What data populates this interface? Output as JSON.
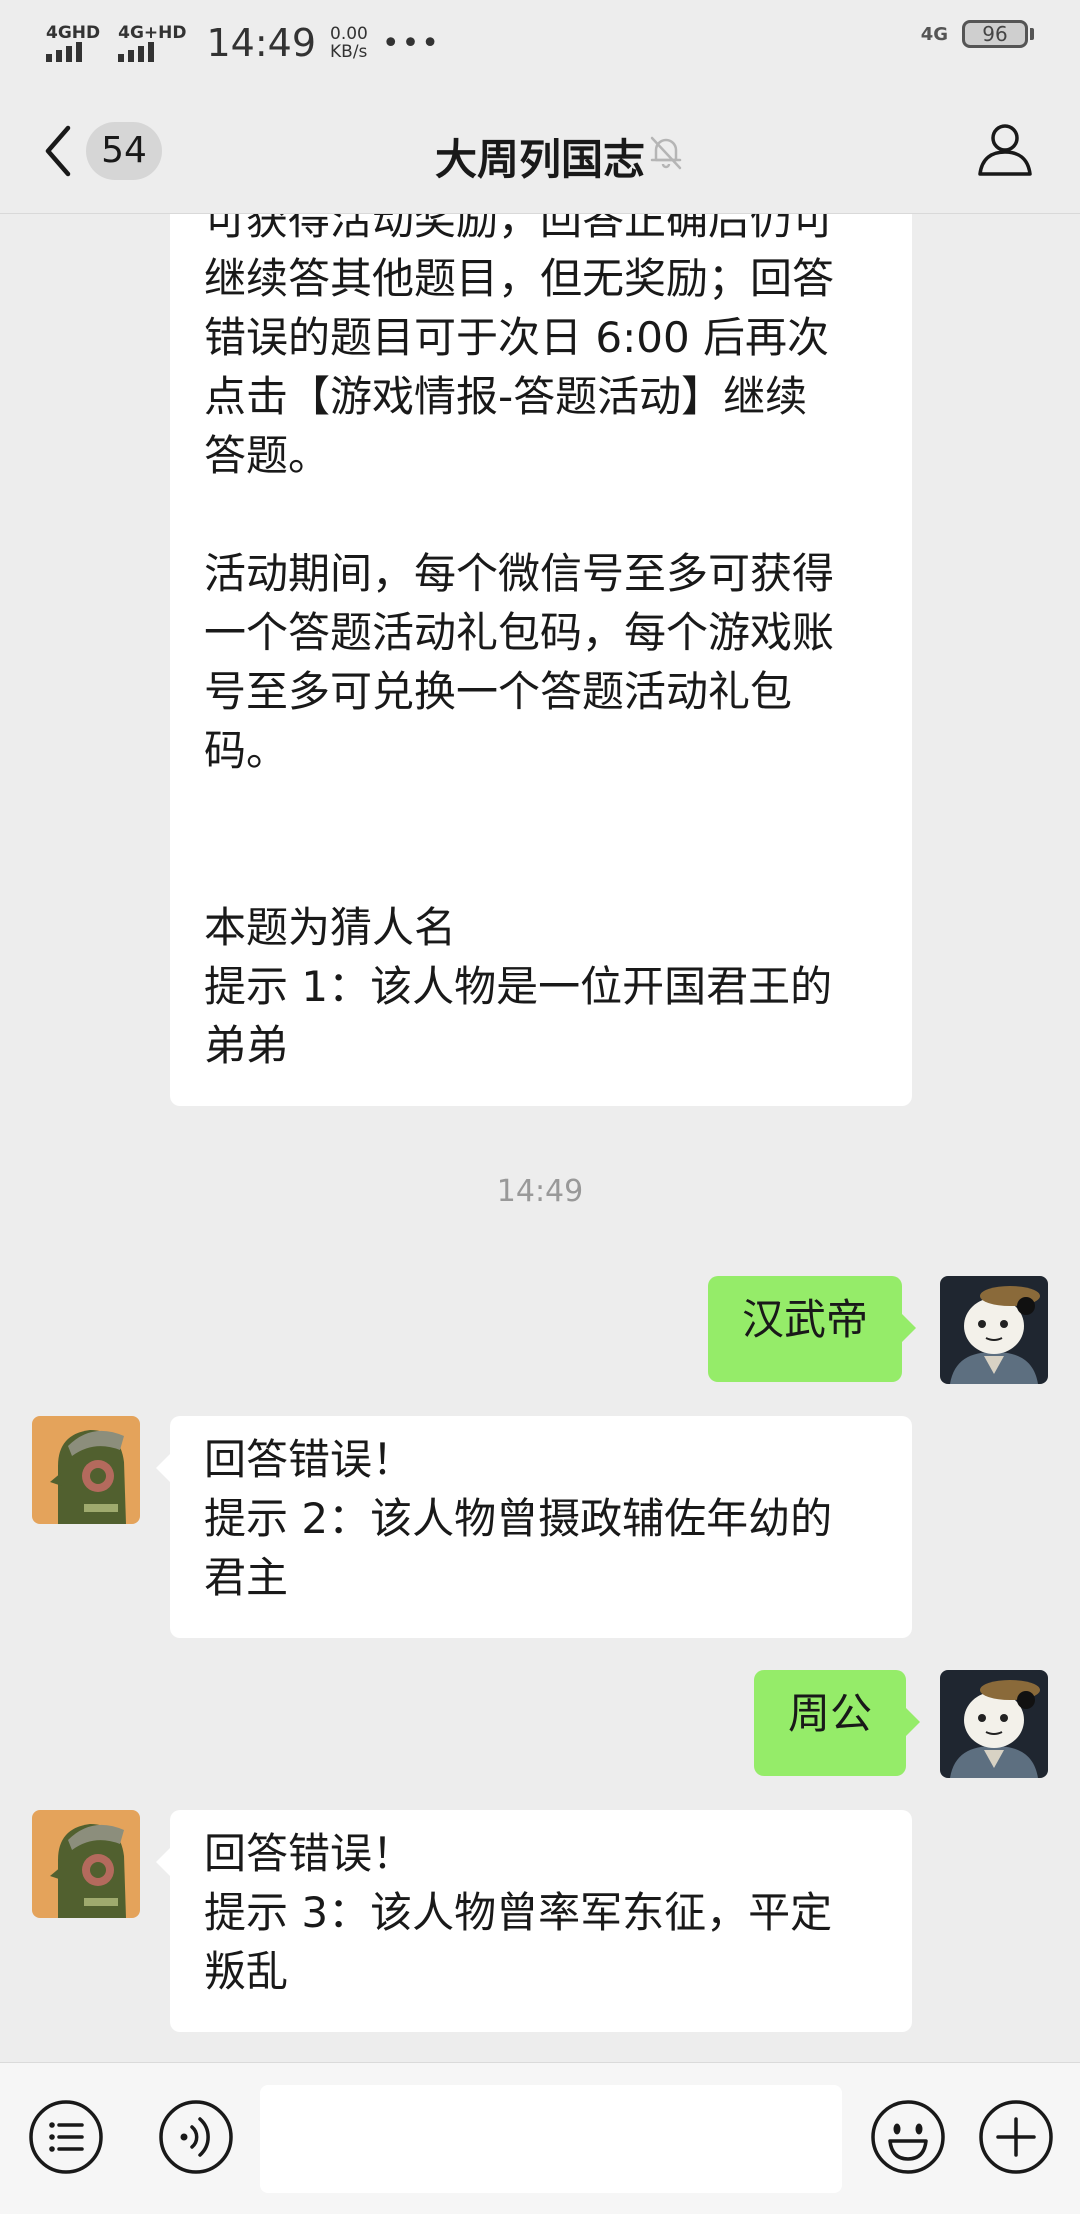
{
  "status_bar": {
    "signal1_label": "4GHD",
    "signal2_label": "4G+HD",
    "time": "14:49",
    "speed_value": "0.00",
    "speed_unit": "KB/s",
    "more": "•••",
    "network": "4G",
    "battery": "96"
  },
  "nav": {
    "unread_count": "54",
    "title": "大周列国志"
  },
  "messages": {
    "m1": "可获得活动奖励，回答正确后仍可\n继续答其他题目，但无奖励；回答\n错误的题目可于次日 6:00 后再次\n点击【游戏情报-答题活动】继续\n答题。\n\n活动期间，每个微信号至多可获得\n一个答题活动礼包码，每个游戏账\n号至多可兑换一个答题活动礼包\n码。\n\n\n本题为猜人名\n提示 1：该人物是一位开国君王的\n弟弟",
    "timestamp": "14:49",
    "m2": "汉武帝",
    "m3": "回答错误！\n提示 2：该人物曾摄政辅佐年幼的\n君主",
    "m4": "周公",
    "m5": "回答错误！\n提示 3：该人物曾率军东征，平定\n叛乱"
  },
  "input_bar": {
    "placeholder": ""
  },
  "colors": {
    "background": "#EDEDED",
    "incoming_bubble": "#FFFFFF",
    "outgoing_bubble": "#95EC69",
    "timestamp_text": "#999999"
  },
  "icons": [
    "back-arrow-icon",
    "mute-bell-icon",
    "profile-icon",
    "menu-list-icon",
    "voice-icon",
    "emoji-icon",
    "plus-icon"
  ]
}
